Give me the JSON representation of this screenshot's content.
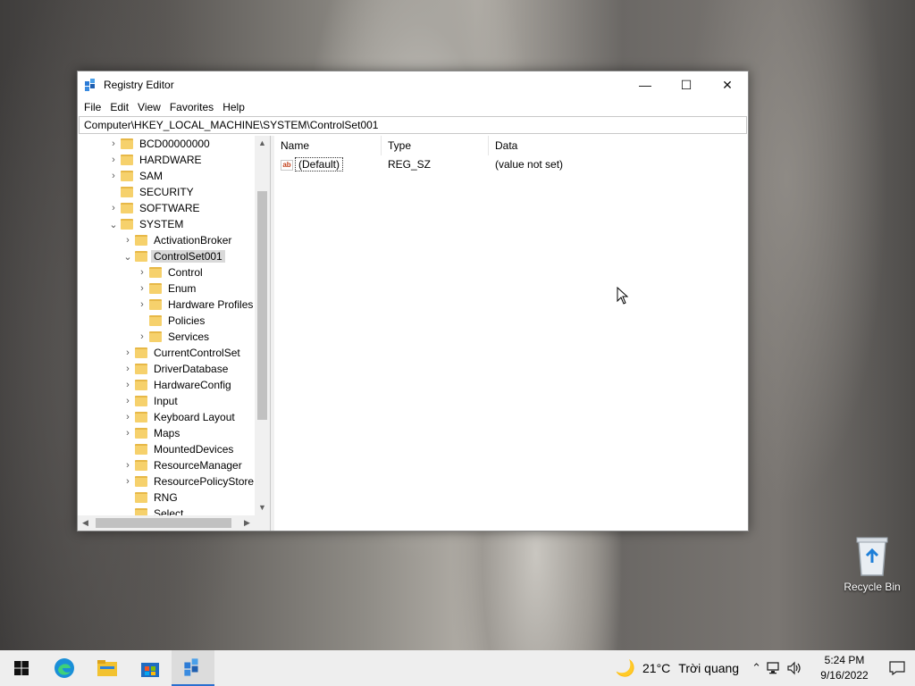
{
  "desktop": {
    "recycle_bin_label": "Recycle Bin"
  },
  "window": {
    "title": "Registry Editor",
    "controls": {
      "minimize": "—",
      "maximize": "☐",
      "close": "✕"
    }
  },
  "menu": [
    "File",
    "Edit",
    "View",
    "Favorites",
    "Help"
  ],
  "address": "Computer\\HKEY_LOCAL_MACHINE\\SYSTEM\\ControlSet001",
  "tree": [
    {
      "label": "BCD00000000",
      "expander": "›"
    },
    {
      "label": "HARDWARE",
      "expander": "›"
    },
    {
      "label": "SAM",
      "expander": "›"
    },
    {
      "label": "SECURITY",
      "expander": ""
    },
    {
      "label": "SOFTWARE",
      "expander": "›"
    },
    {
      "label": "SYSTEM",
      "expander": "⌄"
    },
    {
      "label": "ActivationBroker",
      "expander": "›"
    },
    {
      "label": "ControlSet001",
      "expander": "⌄"
    },
    {
      "label": "Control",
      "expander": "›"
    },
    {
      "label": "Enum",
      "expander": "›"
    },
    {
      "label": "Hardware Profiles",
      "expander": "›"
    },
    {
      "label": "Policies",
      "expander": ""
    },
    {
      "label": "Services",
      "expander": "›"
    },
    {
      "label": "CurrentControlSet",
      "expander": "›"
    },
    {
      "label": "DriverDatabase",
      "expander": "›"
    },
    {
      "label": "HardwareConfig",
      "expander": "›"
    },
    {
      "label": "Input",
      "expander": "›"
    },
    {
      "label": "Keyboard Layout",
      "expander": "›"
    },
    {
      "label": "Maps",
      "expander": "›"
    },
    {
      "label": "MountedDevices",
      "expander": ""
    },
    {
      "label": "ResourceManager",
      "expander": "›"
    },
    {
      "label": "ResourcePolicyStore",
      "expander": "›"
    },
    {
      "label": "RNG",
      "expander": ""
    },
    {
      "label": "Select",
      "expander": ""
    }
  ],
  "list": {
    "columns": [
      "Name",
      "Type",
      "Data"
    ],
    "rows": [
      {
        "icon": "ab",
        "name": "(Default)",
        "type": "REG_SZ",
        "data": "(value not set)"
      }
    ]
  },
  "taskbar": {
    "weather_temp": "21°C",
    "weather_text": "Trời quang",
    "time": "5:24 PM",
    "date": "9/16/2022"
  },
  "colors": {
    "folder": "#f6d16c",
    "accent": "#2a6fcf"
  }
}
